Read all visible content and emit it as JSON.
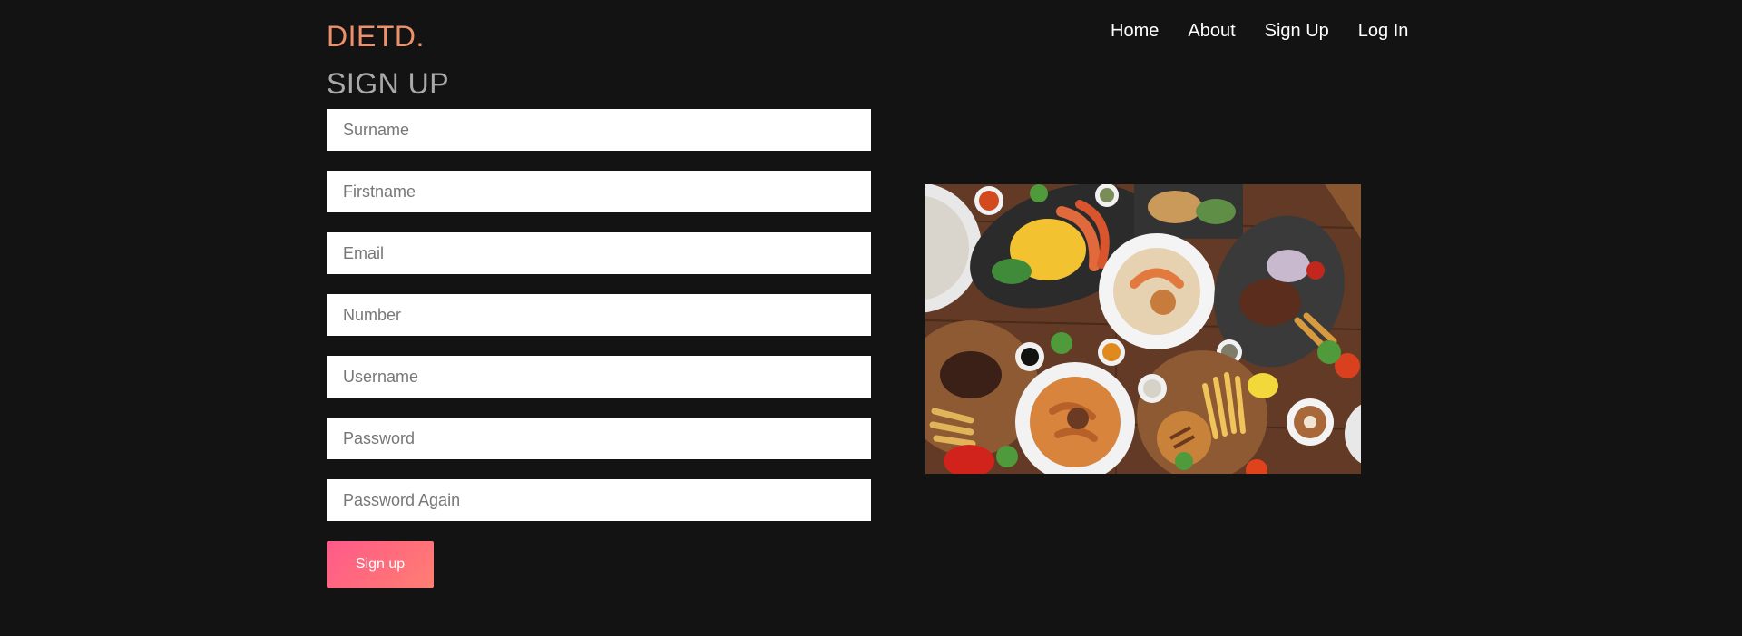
{
  "brand": {
    "logo": "DIETD."
  },
  "nav": {
    "items": [
      "Home",
      "About",
      "Sign Up",
      "Log In"
    ]
  },
  "signup": {
    "title": "SIGN UP",
    "fields": {
      "surname": "Surname",
      "firstname": "Firstname",
      "email": "Email",
      "number": "Number",
      "username": "Username",
      "password": "Password",
      "password_again": "Password Again"
    },
    "submit_label": "Sign up"
  },
  "image": {
    "subject": "food-platter-photo"
  },
  "colors": {
    "background": "#131313",
    "logo": "#f0906a",
    "title": "#a9a9a9",
    "button_start": "#ff5a8a",
    "button_end": "#ff7f72"
  }
}
